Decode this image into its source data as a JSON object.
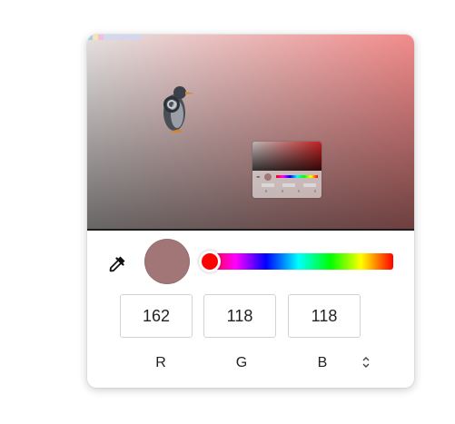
{
  "picker": {
    "selected_color": "#a27676",
    "hue_color": "#ff0000",
    "hue": 0,
    "rgb": {
      "r": "162",
      "g": "118",
      "b": "118"
    },
    "labels": {
      "r": "R",
      "g": "G",
      "b": "B"
    },
    "icons": {
      "eyedropper": "eyedropper-icon",
      "mode_toggle": "up-down-arrows-icon"
    },
    "mode_toggle_glyph": "⌃⌄"
  }
}
